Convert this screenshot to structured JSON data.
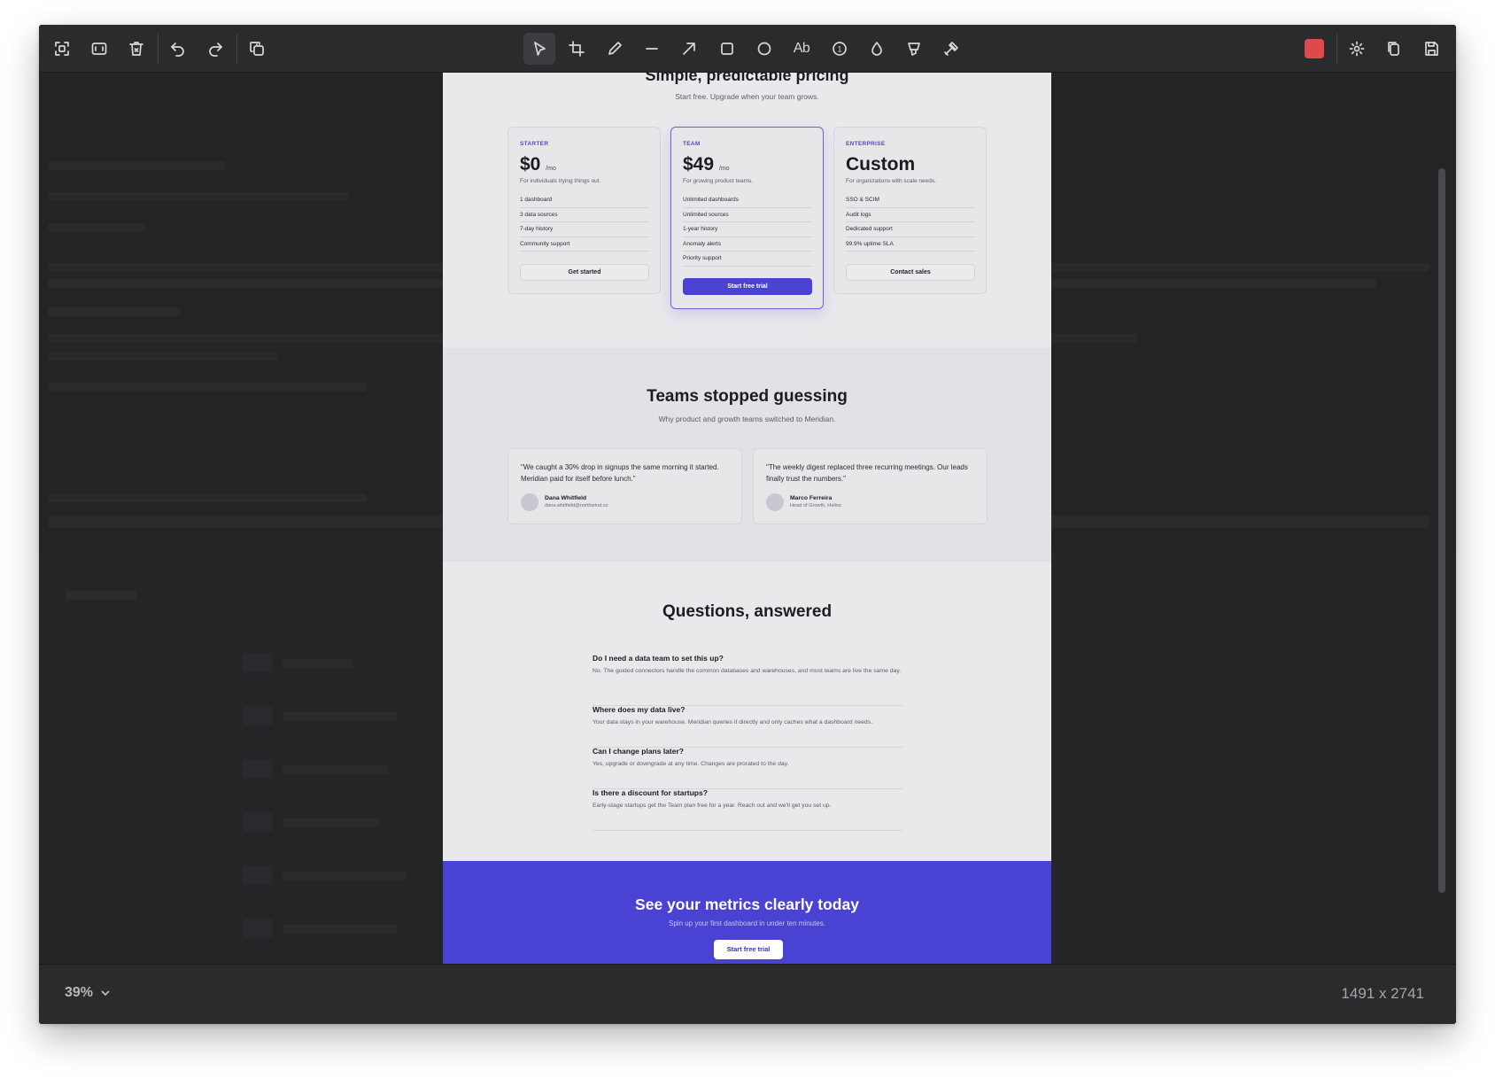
{
  "toolbar": {
    "left_tools": [
      "capture-area",
      "capture-window",
      "delete",
      "undo",
      "redo",
      "duplicate"
    ],
    "center_tools": [
      "select",
      "crop",
      "pen",
      "line",
      "arrow",
      "rectangle",
      "ellipse",
      "text",
      "counter",
      "blur",
      "highlighter",
      "pixelate"
    ],
    "text_tool_label": "Ab",
    "counter_label": "1",
    "accent_color": "#e0494a",
    "right_tools": [
      "settings",
      "copy",
      "save"
    ]
  },
  "screenshot": {
    "pricing": {
      "title": "Simple, predictable pricing",
      "subtitle": "Start free. Upgrade when your team grows.",
      "plans": [
        {
          "tier": "STARTER",
          "price": "$0",
          "per": "/mo",
          "description": "For individuals trying things out.",
          "features": [
            "1 dashboard",
            "3 data sources",
            "7-day history",
            "Community support"
          ],
          "button": "Get started"
        },
        {
          "tier": "TEAM",
          "price": "$49",
          "per": "/mo",
          "description": "For growing product teams.",
          "features": [
            "Unlimited dashboards",
            "Unlimited sources",
            "1-year history",
            "Anomaly alerts",
            "Priority support"
          ],
          "button": "Start free trial"
        },
        {
          "tier": "ENTERPRISE",
          "price": "Custom",
          "per": "",
          "description": "For organizations with scale needs.",
          "features": [
            "SSO & SCIM",
            "Audit logs",
            "Dedicated support",
            "99.9% uptime SLA"
          ],
          "button": "Contact sales"
        }
      ]
    },
    "testimonials": {
      "title": "Teams stopped guessing",
      "subtitle": "Why product and growth teams switched to Meridian.",
      "items": [
        {
          "quote": "\"We caught a 30% drop in signups the same morning it started. Meridian paid for itself before lunch.\"",
          "name": "Dana Whitfield",
          "role": "dana.whitfield@northwind.co"
        },
        {
          "quote": "\"The weekly digest replaced three recurring meetings. Our leads finally trust the numbers.\"",
          "name": "Marco Ferreira",
          "role": "Head of Growth, Helios"
        }
      ]
    },
    "faq": {
      "title": "Questions, answered",
      "items": [
        {
          "q": "Do I need a data team to set this up?",
          "a": "No. The guided connectors handle the common databases and warehouses, and most teams are live the same day."
        },
        {
          "q": "Where does my data live?",
          "a": "Your data stays in your warehouse. Meridian queries it directly and only caches what a dashboard needs."
        },
        {
          "q": "Can I change plans later?",
          "a": "Yes, upgrade or downgrade at any time. Changes are prorated to the day."
        },
        {
          "q": "Is there a discount for startups?",
          "a": "Early-stage startups get the Team plan free for a year. Reach out and we'll get you set up."
        }
      ]
    },
    "cta": {
      "title": "See your metrics clearly today",
      "subtitle": "Spin up your first dashboard in under ten minutes.",
      "button": "Start free trial"
    }
  },
  "status": {
    "zoom": "39%",
    "dimensions": "1491 x 2741"
  }
}
